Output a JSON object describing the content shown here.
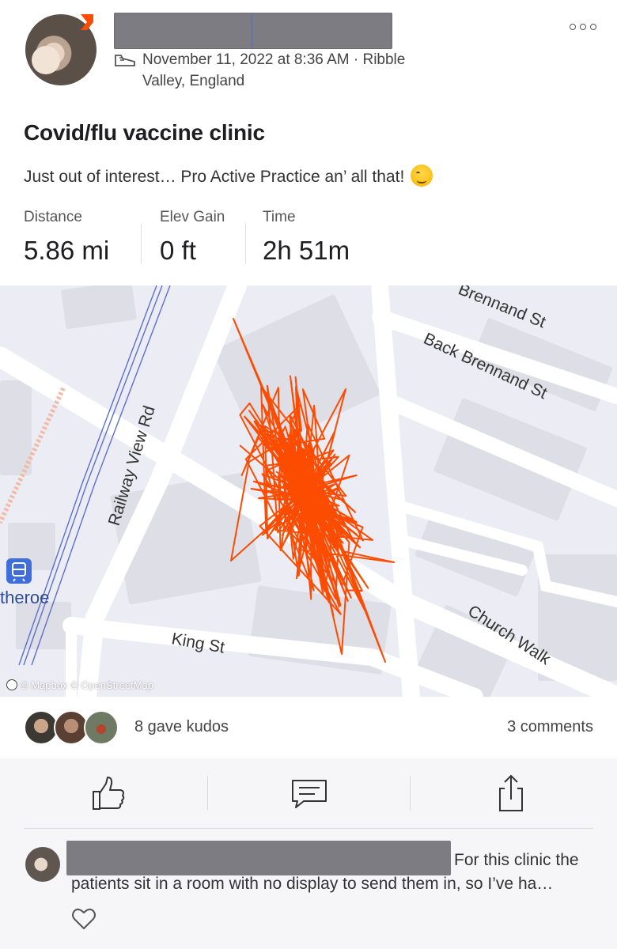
{
  "post": {
    "date_location": "November 11, 2022 at 8:36 AM · Ribble Valley, England",
    "title": "Covid/flu vaccine clinic",
    "description": "Just out of interest… Pro Active Practice an’ all that!"
  },
  "stats": [
    {
      "label": "Distance",
      "value": "5.86 mi"
    },
    {
      "label": "Elev Gain",
      "value": "0 ft"
    },
    {
      "label": "Time",
      "value": "2h 51m"
    }
  ],
  "map": {
    "streets": {
      "brennand": "Brennand St",
      "back_brennand": "Back Brennand St",
      "railway_view": "Railway View Rd",
      "king": "King St",
      "church_walk": "Church Walk"
    },
    "station_label": "theroe",
    "attribution": "© Mapbox © OpenStreetMap",
    "route_color": "#fc4c02"
  },
  "social": {
    "kudos": "8 gave kudos",
    "comments": "3 comments"
  },
  "actions": {
    "kudos_icon": "thumbs-up-icon",
    "comment_icon": "comment-icon",
    "share_icon": "share-icon"
  },
  "comment": {
    "text": "For this clinic the patients sit in a room with no display to send them in, so I’ve ha…"
  }
}
